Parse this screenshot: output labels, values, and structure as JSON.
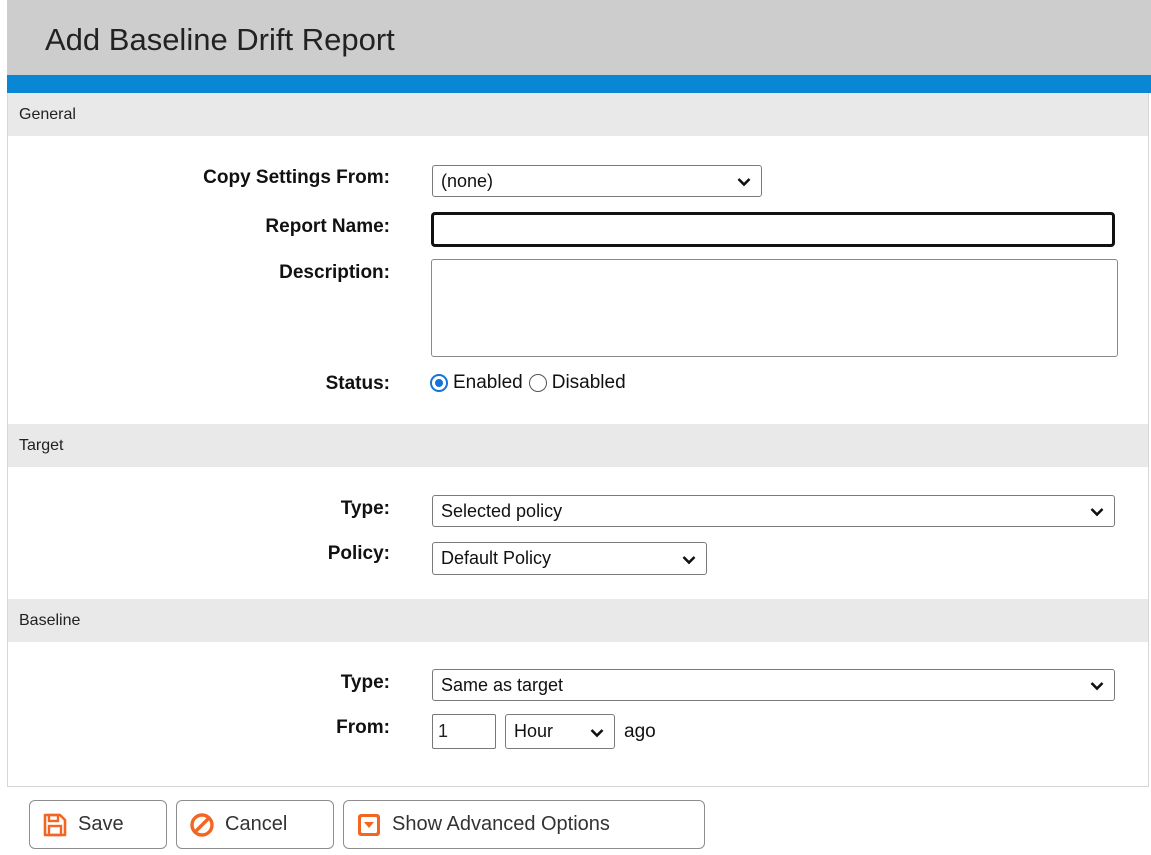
{
  "page": {
    "title": "Add Baseline Drift Report"
  },
  "sections": {
    "general": "General",
    "target": "Target",
    "baseline": "Baseline"
  },
  "general": {
    "copy_settings_label": "Copy Settings From:",
    "copy_settings_value": "(none)",
    "report_name_label": "Report Name:",
    "report_name_value": "",
    "description_label": "Description:",
    "description_value": "",
    "status_label": "Status:",
    "status_enabled": "Enabled",
    "status_disabled": "Disabled",
    "status_selected": "Enabled"
  },
  "target": {
    "type_label": "Type:",
    "type_value": "Selected policy",
    "policy_label": "Policy:",
    "policy_value": "Default Policy"
  },
  "baseline": {
    "type_label": "Type:",
    "type_value": "Same as target",
    "from_label": "From:",
    "from_number": "1",
    "from_unit": "Hour",
    "from_suffix": "ago"
  },
  "buttons": {
    "save": "Save",
    "cancel": "Cancel",
    "advanced": "Show Advanced Options"
  },
  "colors": {
    "accent_bar": "#0a87d4",
    "button_icon": "#f26522",
    "radio_selected": "#1673d3"
  },
  "icons": {
    "save": "floppy-disk-icon",
    "cancel": "no-entry-icon",
    "advanced": "dropdown-box-icon",
    "select_arrow": "chevron-down-icon"
  }
}
